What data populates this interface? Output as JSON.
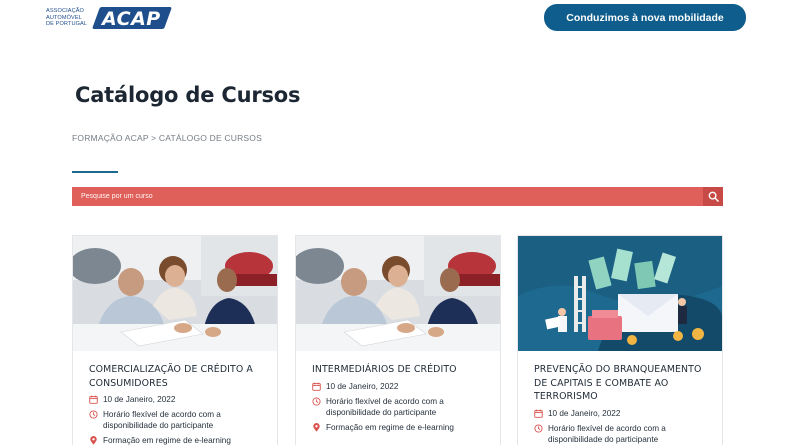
{
  "header": {
    "logo_text_lines": [
      "ASSOCIAÇÃO",
      "AUTOMÓVEL",
      "DE PORTUGAL"
    ],
    "logo_word": "ACAP",
    "cta_label": "Conduzimos à nova mobilidade"
  },
  "page": {
    "title": "Catálogo de Cursos",
    "breadcrumb": "FORMAÇÃO ACAP > CATÁLOGO DE CURSOS"
  },
  "search": {
    "placeholder": "Pesquise por um curso",
    "icon": "search-icon"
  },
  "colors": {
    "brand": "#1f4e8c",
    "cta": "#0f5d8c",
    "search": "#df5f5b",
    "icon_red": "#d9534f"
  },
  "courses": [
    {
      "title": "COMERCIALIZAÇÃO DE CRÉDITO A CONSUMIDORES",
      "image": "people-signing-contract-photo",
      "date": "10 de Janeiro, 2022",
      "schedule": "Horário flexível de acordo com a disponibilidade do participante",
      "format": "Formação em regime de e-learning"
    },
    {
      "title": "INTERMEDIÁRIOS DE CRÉDITO",
      "image": "people-signing-contract-photo",
      "date": "10 de Janeiro, 2022",
      "schedule": "Horário flexível de acordo com a disponibilidade do participante",
      "format": "Formação em regime de e-learning"
    },
    {
      "title": "PREVENÇÃO DO BRANQUEAMENTO DE CAPITAIS E COMBATE AO TERRORISMO",
      "image": "money-laundering-illustration",
      "date": "10 de Janeiro, 2022",
      "schedule": "Horário flexível de acordo com a disponibilidade do participante"
    }
  ]
}
